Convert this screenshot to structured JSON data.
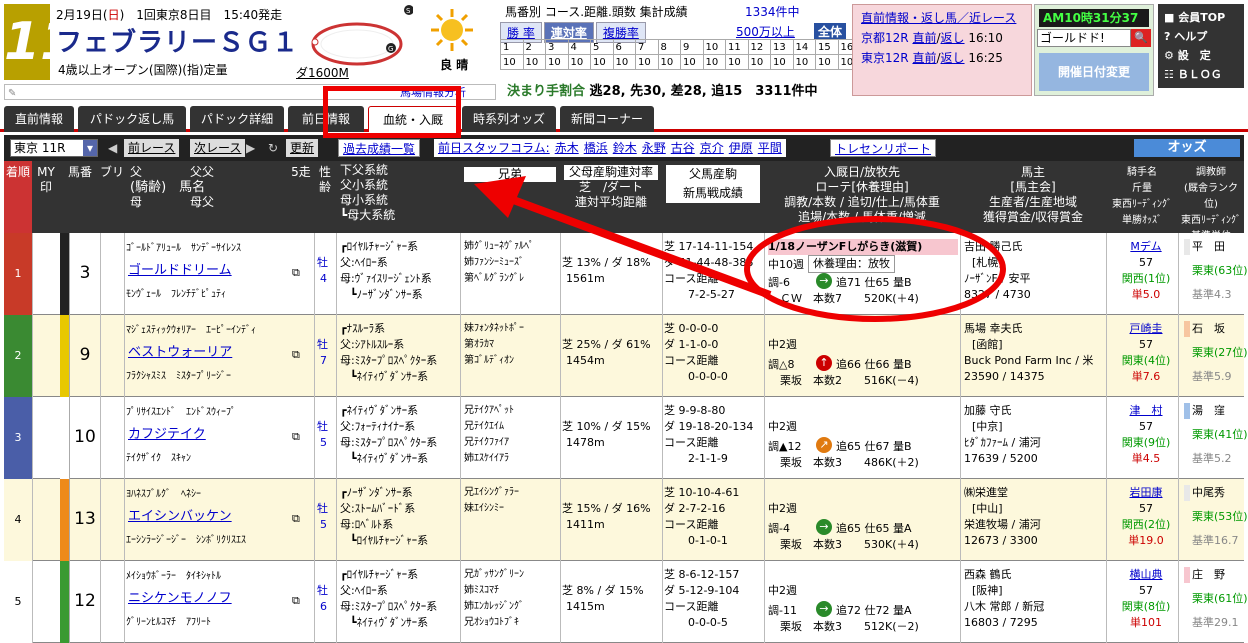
{
  "header": {
    "race_no": "11",
    "date_prefix": "2月19日(",
    "weekday": "日",
    "date_suffix": ")　1回東京8日目　15:40発走",
    "race_name": "フェブラリーＳＧ１",
    "conditions": "4歳以上オープン(国際)(指)定量",
    "distance": "ダ1600M",
    "weather": "晴",
    "track_condition": "良",
    "weather_label": "良 晴"
  },
  "stats": {
    "title": "馬番別 コース.距離.頭数 集計成績",
    "count": "1334件中",
    "tabs": [
      "勝 率",
      "連対率",
      "複勝率"
    ],
    "amount": "500万以上",
    "all": "全体",
    "grid_row1": [
      "1",
      "2",
      "3",
      "4",
      "5",
      "6",
      "7",
      "8",
      "9",
      "10",
      "11",
      "12",
      "13",
      "14",
      "15",
      "16"
    ],
    "grid_row2": [
      "10",
      "10",
      "10",
      "10",
      "10",
      "10",
      "10",
      "10",
      "10",
      "10",
      "10",
      "10",
      "10",
      "10",
      "10",
      "10"
    ],
    "kimari_label": "決まり手割合",
    "kimari_value": "逃28, 先30, 差28, 追15　3311件中"
  },
  "side": {
    "title": "直前情報・返し馬／近レース",
    "line1_race": "京都12R",
    "line1_a": "直前",
    "line1_b": "返し",
    "line1_time": "16:10",
    "line2_race": "東京12R",
    "line2_a": "直前",
    "line2_b": "返し",
    "line2_time": "16:25",
    "clock": "AM10時31分37秒",
    "search_value": "ゴールドド!",
    "kaisai_button": "開催日付変更"
  },
  "menu": {
    "items": [
      "会員TOP",
      "ヘルプ",
      "設　定",
      "ＢＬＯＧ"
    ]
  },
  "bunseki": "馬場情報分析",
  "tabs": [
    "直前情報",
    "パドック返し馬",
    "パドック詳細",
    "前日情報",
    "血統・入厩",
    "時系列オッズ",
    "新聞コーナー"
  ],
  "subbar": {
    "race_select": "東京 11R",
    "prev": "前レース",
    "next": "次レース",
    "update": "更新",
    "past": "過去成績一覧",
    "column_label": "前日スタッフコラム:",
    "staff": [
      "赤木",
      "橋浜",
      "鈴木",
      "永野",
      "古谷",
      "京介",
      "伊原",
      "平間"
    ],
    "tracen": "トレセンリポート",
    "odds": "オッズ"
  },
  "columns": {
    "rank": "着順",
    "my": "MY印",
    "umaban": "馬番",
    "blinker": "ブリ",
    "pedigree": [
      "父　　　　父父",
      "(騎齢)　馬名",
      "母　　　　母父"
    ],
    "gait": "5走",
    "sexage": "性齢",
    "lineage": [
      "下父系統",
      "父小系統",
      "母小系統",
      "┗母大系統"
    ],
    "sibling": "兄弟",
    "sire_rate": [
      "父母産駒連対率",
      "芝　/ダート",
      "連対平均距離"
    ],
    "sire_new": [
      "父馬産駒",
      "新馬戦成績"
    ],
    "stable": [
      "入厩日/放牧先",
      "ローテ[休養理由]",
      "調教/本数 / 追切/仕上/馬体重",
      "追場/本数 / 馬体重/増減"
    ],
    "owner": [
      "馬主",
      "[馬主会]",
      "生産者/生産地域",
      "獲得賞金/収得賞金"
    ],
    "jockey": [
      "騎手名",
      "斤量",
      "東西ﾘｰﾃﾞｨﾝｸﾞ",
      "単勝ｵｯｽﾞ"
    ],
    "trainer": [
      "調教師",
      "(厩舎ランク位)",
      "東西ﾘｰﾃﾞｨﾝｸﾞ",
      "基準単位"
    ]
  },
  "rows": [
    {
      "rank": "1",
      "rank_color": "#c83a28",
      "waku_color": "#222",
      "umaban": "3",
      "sire": "ｺﾞｰﾙﾄﾞｱﾘｭｰﾙ　ｻﾝﾃﾞｰｻｲﾚﾝｽ",
      "name": "ゴールドドリーム",
      "dam": "ﾓﾝｳﾞｪｰﾙ　ﾌﾚﾝﾁﾃﾞﾋﾟｭﾃｨ",
      "sex": "牡",
      "age": "4",
      "lin1": "┏ﾛｲﾔﾙﾁｬｰｼﾞｬｰ系",
      "lin2": "父:ﾍｲﾛｰ系",
      "lin3": "母:ｳﾞｧｲｽﾘｰｼﾞｪﾝﾄ系",
      "lin4": "┗ﾉｰｻﾞﾝﾀﾞﾝｻｰ系",
      "sib1": "姉ｸﾞﾘｭｰﾈｳﾞｧﾙﾍﾟ",
      "sib2": "姉ﾌｧﾝｼｰﾐｭｰｽﾞ",
      "sib3": "第ﾍﾞﾙｸﾞﾗﾝｸﾞﾚ",
      "rate1": "芝 13% / ダ 18%",
      "rate2": "1561m",
      "new1": "芝 17-14-11-154",
      "new2": "ダ 51-44-48-388",
      "new3": "コース距離",
      "new4": "7-2-5-27",
      "st1": "1/18ノーザンFしがらき(滋賀)",
      "st2": "中10週",
      "st2b": "休養理由：放牧",
      "st3": "調-6",
      "st3b": "追71 仕65 量B",
      "st4": "ＣＷ　本数7",
      "st4b": "520K(＋4)",
      "own1": "吉田 勝己氏",
      "own2": "[札幌]",
      "own3": "ﾉｰｻﾞﾝF / 安平",
      "own4": "8327 / 4730",
      "jk1": "Mデム",
      "jk2": "57",
      "jk3": "関西(1位)",
      "jk4": "単5.0",
      "tr1": "平　田",
      "tr2": "栗東(63位)",
      "tr3": "基準4.3",
      "row_bg": "#fff"
    },
    {
      "rank": "2",
      "rank_color": "#3a8a32",
      "waku_color": "#e8c800",
      "umaban": "9",
      "sire": "ﾏｼﾞｪｽﾃｨｯｸｳｫﾘｱｰ　ｴｰﾋﾟｰｲﾝﾃﾞｨ",
      "name": "ベストウォーリア",
      "dam": "ﾌﾗｸｼｬｽﾐｽ　ﾐｽﾀｰﾌﾟﾘｰｼﾞｰ",
      "sex": "牡",
      "age": "7",
      "lin1": "┏ﾅｽﾙｰﾗ系",
      "lin2": "父:ｼｱﾄﾙｽﾙｰ系",
      "lin3": "母:ﾐｽﾀｰﾌﾟﾛｽﾍﾟｸﾀｰ系",
      "lin4": "┗ﾈｲﾃｨｳﾞﾀﾞﾝｻｰ系",
      "sib1": "妹ﾌｫﾝﾀﾈｯﾄﾎﾟｰ",
      "sib2": "第ｵﾗｶﾏ",
      "sib3": "第ｺﾞﾙﾃﾞｨｵﾝ",
      "rate1": "芝 25% / ダ 61%",
      "rate2": "1454m",
      "new1": "芝 0-0-0-0",
      "new2": "ダ 1-1-0-0",
      "new3": "コース距離",
      "new4": "0-0-0-0",
      "st1": "",
      "st2": "中2週",
      "st2b": "",
      "st3": "調△8",
      "st3b": "追66 仕66 量B",
      "st4": "栗坂　本数2",
      "st4b": "516K(－4)",
      "own1": "馬場 幸夫氏",
      "own2": "[函館]",
      "own3": "Buck Pond Farm Inc / 米",
      "own4": "23590 / 14375",
      "jk1": "戸崎圭",
      "jk2": "57",
      "jk3": "関東(4位)",
      "jk4": "単7.6",
      "tr1": "石　坂",
      "tr2": "栗東(27位)",
      "tr3": "基準5.9",
      "row_bg": "#fdf8dc"
    },
    {
      "rank": "3",
      "rank_color": "#4a5ea8",
      "waku_color": "#fff",
      "umaban": "10",
      "sire": "ﾌﾟﾘｻｲｽｴﾝﾄﾞ　ｴﾝﾄﾞｽｳｨｰﾌﾟ",
      "name": "カフジテイク",
      "dam": "ﾃｲｸｻﾞｲｸ　ｽｷｬﾝ",
      "sex": "牡",
      "age": "5",
      "lin1": "┏ﾈｲﾃｨｳﾞﾀﾞﾝｻｰ系",
      "lin2": "父:ﾌｫｰﾃｨﾅｲﾅｰ系",
      "lin3": "母:ﾐｽﾀｰﾌﾟﾛｽﾍﾟｸﾀｰ系",
      "lin4": "┗ﾈｲﾃｨｳﾞﾀﾞﾝｻｰ系",
      "sib1": "兄ﾃｲｸｱﾍﾟｯﾄ",
      "sib2": "兄ﾃｲｸｴｲﾑ",
      "sib3": "兄ﾃｲｸﾌｧｲｱ",
      "sib4": "姉ｴｽｹｲｲｱﾗ",
      "rate1": "芝 10% / ダ 15%",
      "rate2": "1478m",
      "new1": "芝 9-9-8-80",
      "new2": "ダ 19-18-20-134",
      "new3": "コース距離",
      "new4": "2-1-1-9",
      "st1": "",
      "st2": "中2週",
      "st2b": "",
      "st3": "調▲12",
      "st3b": "追65 仕67 量B",
      "st4": "栗坂　本数3",
      "st4b": "486K(＋2)",
      "own1": "加藤 守氏",
      "own2": "[中京]",
      "own3": "ﾋﾀﾞｶﾌｧｰﾑ / 浦河",
      "own4": "17639 / 5200",
      "jk1": "津　村",
      "jk2": "57",
      "jk3": "関東(9位)",
      "jk4": "単4.5",
      "tr1": "湯　窪",
      "tr2": "栗東(41位)",
      "tr3": "基準5.2",
      "row_bg": "#fff"
    },
    {
      "rank": "4",
      "rank_color": "#fdf8dc",
      "waku_color": "#ee8a1a",
      "umaban": "13",
      "sire": "ﾖﾊﾈｽﾌﾞﾙｸﾞ　ﾍﾈｼｰ",
      "name": "エイシンバッケン",
      "dam": "ｴｰｼﾝﾗｰｼﾞｰｼﾞｰ　ｼﾝﾎﾞﾘｸﾘｽｴｽ",
      "sex": "牡",
      "age": "5",
      "lin1": "┏ﾉｰｻﾞﾝﾀﾞﾝｻｰ系",
      "lin2": "父:ｽﾄｰﾑﾊﾞｰﾄﾞ系",
      "lin3": "母:ﾛﾍﾞﾙﾄ系",
      "lin4": "┗ﾛｲﾔﾙﾁｬｰｼﾞｬｰ系",
      "sib1": "兄ｴｲｼﾝｸﾞｧﾗｰ",
      "sib2": "妹ｴｲｼﾝﾐｰ",
      "sib3": "",
      "rate1": "芝 15% / ダ 16%",
      "rate2": "1411m",
      "new1": "芝 10-10-4-61",
      "new2": "ダ 2-7-2-16",
      "new3": "コース距離",
      "new4": "0-1-0-1",
      "st1": "",
      "st2": "中2週",
      "st2b": "",
      "st3": "調-4",
      "st3b": "追65 仕65 量A",
      "st4": "栗坂　本数3",
      "st4b": "530K(＋4)",
      "own1": "㈱栄進堂",
      "own2": "[中山]",
      "own3": "栄進牧場 / 浦河",
      "own4": "12673 / 3300",
      "jk1": "岩田康",
      "jk2": "57",
      "jk3": "関西(2位)",
      "jk4": "単19.0",
      "tr1": "中尾秀",
      "tr2": "栗東(53位)",
      "tr3": "基準16.7",
      "row_bg": "#fdf8dc"
    },
    {
      "rank": "5",
      "rank_color": "#fff",
      "waku_color": "#3a9a32",
      "umaban": "12",
      "sire": "ﾒｲｼｮｳﾎﾞｰﾗｰ　ﾀｲｷｼｬﾄﾙ",
      "name": "ニシケンモノノフ",
      "dam": "ｸﾞﾘｰﾝﾋﾙｺﾏﾁ　ｱﾌﾘｰﾄ",
      "sex": "牡",
      "age": "6",
      "lin1": "┏ﾛｲﾔﾙﾁｬｰｼﾞｬｰ系",
      "lin2": "父:ﾍｲﾛｰ系",
      "lin3": "母:ﾐｽﾀｰﾌﾟﾛｽﾍﾟｸﾀｰ系",
      "lin4": "┗ﾈｲﾃｨｳﾞﾀﾞﾝｻｰ系",
      "sib1": "兄ｶﾞｯｻﾝｸﾞﾘｰﾝ",
      "sib2": "姉ﾐｽｺﾏﾁ",
      "sib3": "姉ｴﾝｶﾚｯｼﾞﾝｸﾞ",
      "sib4": "兄ｵｼｮｳｺﾄﾌﾞｷ",
      "rate1": "芝 8% / ダ 15%",
      "rate2": "1415m",
      "new1": "芝 8-6-12-157",
      "new2": "ダ 5-12-9-104",
      "new3": "コース距離",
      "new4": "0-0-0-5",
      "st1": "",
      "st2": "中2週",
      "st2b": "",
      "st3": "調-11",
      "st3b": "追72 仕72 量A",
      "st4": "栗坂　本数3",
      "st4b": "512K(－2)",
      "own1": "西森 鶴氏",
      "own2": "[阪神]",
      "own3": "八木 常郎 / 新冠",
      "own4": "16803 / 7295",
      "jk1": "横山典",
      "jk2": "57",
      "jk3": "関東(8位)",
      "jk4": "単101",
      "tr1": "庄　野",
      "tr2": "栗東(61位)",
      "tr3": "基準29.1",
      "row_bg": "#fff"
    }
  ],
  "colors": {
    "accent_red": "#cc0000",
    "header_dark": "#333333",
    "link": "#0000cc"
  }
}
